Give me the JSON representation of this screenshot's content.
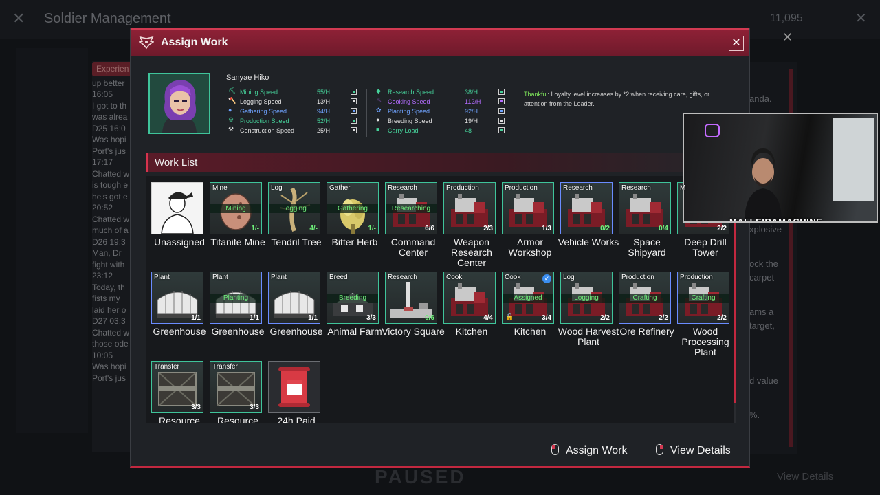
{
  "background": {
    "title": "Soldier Management",
    "coins": "11,095",
    "chat_tag": "Experien",
    "chat_lines": [
      "up better",
      "16:05",
      "I got to th",
      "was alrea",
      "D25 16:0",
      "Was hopi",
      "Port's jus",
      "17:17",
      "Chatted w",
      "is tough e",
      "he's got e",
      "20:52",
      "Chatted w",
      "much of a",
      "D26 19:3",
      "Man, Dr",
      "fight with",
      "23:12",
      "Today, th",
      "fists my",
      "laid her o",
      "D27 03:3",
      "Chatted w",
      "those ode",
      "10:05",
      "Was hopi",
      "Port's jus"
    ],
    "right_lines": [
      "anda.",
      "xplosive",
      "ock the",
      "carpet",
      "ams a",
      "target,",
      "d value",
      "%."
    ],
    "paused": "PAUSED",
    "view_details": "View Details"
  },
  "modal": {
    "title": "Assign Work",
    "close_label": "✕"
  },
  "soldier": {
    "name": "Sanyae Hiko",
    "stats_left": [
      {
        "label": "Mining Speed",
        "value": "55/H",
        "tone": "green",
        "icon": "⛏"
      },
      {
        "label": "Logging Speed",
        "value": "13/H",
        "tone": "white",
        "icon": "🪓"
      },
      {
        "label": "Gathering Speed",
        "value": "94/H",
        "tone": "blue",
        "icon": "●"
      },
      {
        "label": "Production Speed",
        "value": "52/H",
        "tone": "green",
        "icon": "⚙"
      },
      {
        "label": "Construction Speed",
        "value": "25/H",
        "tone": "white",
        "icon": "⚒"
      }
    ],
    "stats_right": [
      {
        "label": "Research Speed",
        "value": "38/H",
        "tone": "green",
        "icon": "◆"
      },
      {
        "label": "Cooking Speed",
        "value": "112/H",
        "tone": "purple",
        "icon": "♨"
      },
      {
        "label": "Planting Speed",
        "value": "92/H",
        "tone": "blue",
        "icon": "✿"
      },
      {
        "label": "Breeding Speed",
        "value": "19/H",
        "tone": "white",
        "icon": "●"
      },
      {
        "label": "Carry Load",
        "value": "48",
        "tone": "green",
        "icon": "■"
      }
    ],
    "trait_name": "Thankful",
    "trait_desc": ": Loyalty level increases by *2 when receiving care, gifts, or attention from the Leader."
  },
  "work_list": {
    "title": "Work List",
    "items": [
      {
        "name": "Unassigned",
        "cat": "",
        "status": "",
        "count": "",
        "border": "white"
      },
      {
        "name": "Titanite Mine",
        "cat": "Mine",
        "status": "Mining",
        "count": "1/-",
        "border": "green"
      },
      {
        "name": "Tendril Tree",
        "cat": "Log",
        "status": "Logging",
        "count": "4/-",
        "border": "green"
      },
      {
        "name": "Bitter Herb",
        "cat": "Gather",
        "status": "Gathering",
        "count": "1/-",
        "border": "green"
      },
      {
        "name": "Command Center",
        "cat": "Research",
        "status": "Researching",
        "count": "6/6",
        "border": "green"
      },
      {
        "name": "Weapon Research Center",
        "cat": "Production",
        "status": "",
        "count": "2/3",
        "border": "green"
      },
      {
        "name": "Armor Workshop",
        "cat": "Production",
        "status": "",
        "count": "1/3",
        "border": "green"
      },
      {
        "name": "Vehicle Works",
        "cat": "Research",
        "status": "",
        "count": "0/2",
        "border": "blue"
      },
      {
        "name": "Space Shipyard",
        "cat": "Research",
        "status": "",
        "count": "0/4",
        "border": "green"
      },
      {
        "name": "Deep Drill Tower",
        "cat": "M",
        "status": "",
        "count": "2/2",
        "border": "green"
      },
      {
        "name": "Greenhouse",
        "cat": "Plant",
        "status": "",
        "count": "1/1",
        "border": "blue"
      },
      {
        "name": "Greenhouse",
        "cat": "Plant",
        "status": "Planting",
        "count": "1/1",
        "border": "blue"
      },
      {
        "name": "Greenhouse",
        "cat": "Plant",
        "status": "",
        "count": "1/1",
        "border": "blue"
      },
      {
        "name": "Animal Farm",
        "cat": "Breed",
        "status": "Breeding",
        "count": "3/3",
        "border": "green"
      },
      {
        "name": "Victory Square",
        "cat": "Research",
        "status": "",
        "count": "0/6",
        "border": "green"
      },
      {
        "name": "Kitchen",
        "cat": "Cook",
        "status": "",
        "count": "4/4",
        "border": "green"
      },
      {
        "name": "Kitchen",
        "cat": "Cook",
        "status": "Assigned",
        "count": "3/4",
        "border": "green"
      },
      {
        "name": "Wood Harvest Plant",
        "cat": "Log",
        "status": "Logging",
        "count": "2/2",
        "border": "green"
      },
      {
        "name": "Ore Refinery",
        "cat": "Production",
        "status": "Crafting",
        "count": "2/2",
        "border": "blue"
      },
      {
        "name": "Wood Processing Plant",
        "cat": "Production",
        "status": "Crafting",
        "count": "2/2",
        "border": "blue"
      },
      {
        "name": "Resource",
        "cat": "Transfer",
        "status": "",
        "count": "3/3",
        "border": "green"
      },
      {
        "name": "Resource",
        "cat": "Transfer",
        "status": "",
        "count": "3/3",
        "border": "green"
      },
      {
        "name": "24h Paid",
        "cat": "",
        "status": "",
        "count": "",
        "border": "grey"
      }
    ]
  },
  "footer": {
    "assign_label": "Assign Work",
    "details_label": "View Details"
  },
  "webcam": {
    "streamer": "MALLEIRAMACHINE"
  },
  "colors": {
    "accent": "#c2283f",
    "header": "#8e2136",
    "green": "#46d39b",
    "blue": "#6fa3ff",
    "purple": "#b46cff"
  }
}
